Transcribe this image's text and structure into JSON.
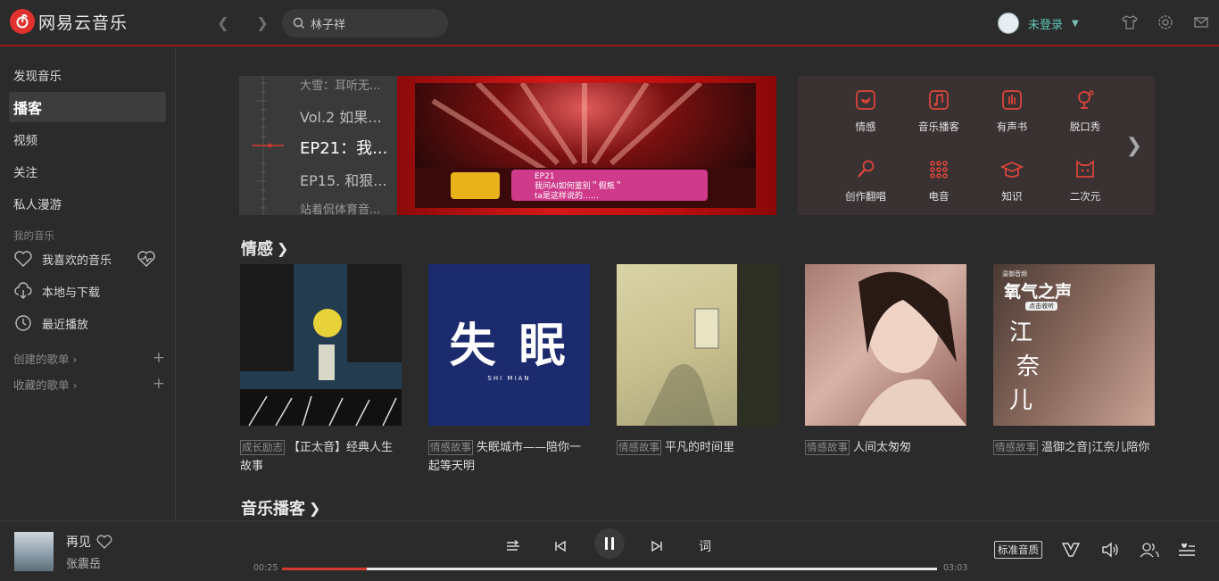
{
  "app": {
    "name": "网易云音乐"
  },
  "search": {
    "value": "林子祥"
  },
  "user": {
    "name": "未登录"
  },
  "sidebar": {
    "items": [
      {
        "label": "发现音乐"
      },
      {
        "label": "播客"
      },
      {
        "label": "视频"
      },
      {
        "label": "关注"
      },
      {
        "label": "私人漫游"
      }
    ],
    "my_music_title": "我的音乐",
    "my_music": [
      {
        "label": "我喜欢的音乐",
        "icon": "heart-icon"
      },
      {
        "label": "本地与下载",
        "icon": "download-icon"
      },
      {
        "label": "最近播放",
        "icon": "clock-icon"
      }
    ],
    "created": "创建的歌单",
    "collected": "收藏的歌单"
  },
  "banner": {
    "episodes": [
      "大雪：耳听无...",
      "Vol.2 如果...",
      "EP21：我...",
      "EP15. 和狠...",
      "站着侃体育音..."
    ]
  },
  "categories": [
    {
      "label": "情感",
      "icon": "emotion-icon"
    },
    {
      "label": "音乐播客",
      "icon": "music-podcast-icon"
    },
    {
      "label": "有声书",
      "icon": "audiobook-icon"
    },
    {
      "label": "脱口秀",
      "icon": "talkshow-icon"
    },
    {
      "label": "创作翻唱",
      "icon": "microphone-icon"
    },
    {
      "label": "电音",
      "icon": "electronic-icon"
    },
    {
      "label": "知识",
      "icon": "knowledge-icon"
    },
    {
      "label": "二次元",
      "icon": "anime-icon"
    }
  ],
  "sections": {
    "emotion": "情感",
    "music_podcast": "音乐播客"
  },
  "cards": [
    {
      "tag": "成长励志",
      "title": "【正太音】经典人生故事"
    },
    {
      "tag": "情感故事",
      "title": "失眠城市——陪你一起等天明"
    },
    {
      "tag": "情感故事",
      "title": "平凡的时间里"
    },
    {
      "tag": "情感故事",
      "title": "人间太匆匆"
    },
    {
      "tag": "情感故事",
      "title": "温御之音|江奈儿陪你"
    }
  ],
  "cover_text": {
    "sleep": "失 眠",
    "sleep_sub": "SHI MIAN",
    "oxygen_small": "温御音频",
    "oxygen": "氧气之声",
    "oxygen_sub": "点击收听",
    "oxygen_name_1": "江",
    "oxygen_name_2": "奈",
    "oxygen_name_3": "儿",
    "ep_badge": "EP21",
    "ep_line1": "我问AI如何鉴别＂假瓶＂",
    "ep_line2": "ta是这样说的……"
  },
  "player": {
    "title": "再见",
    "artist": "张震岳",
    "current_time": "00:25",
    "total_time": "03:03",
    "progress": 0.13,
    "lyrics_label": "词",
    "quality": "标准音质"
  }
}
